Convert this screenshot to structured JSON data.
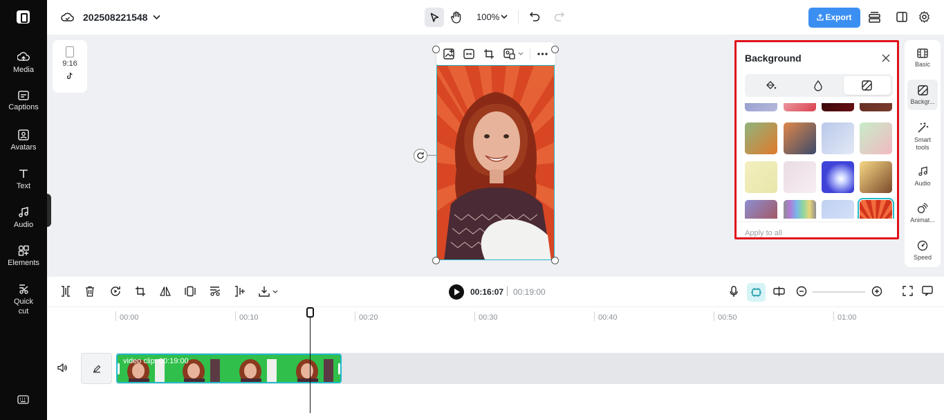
{
  "left_rail": {
    "items": [
      {
        "label": "Media",
        "icon": "media-upload-icon"
      },
      {
        "label": "Captions",
        "icon": "captions-icon"
      },
      {
        "label": "Avatars",
        "icon": "avatar-icon"
      },
      {
        "label": "Text",
        "icon": "text-icon"
      },
      {
        "label": "Audio",
        "icon": "music-note-icon"
      },
      {
        "label": "Elements",
        "icon": "elements-icon"
      },
      {
        "label": "Quick cut",
        "icon": "scissors-icon"
      }
    ]
  },
  "topbar": {
    "project_name": "202508221548",
    "zoom": "100%",
    "export_label": "Export"
  },
  "canvas": {
    "aspect_ratio": "9:16"
  },
  "background_panel": {
    "title": "Background",
    "tabs": [
      {
        "icon": "paint-bucket-icon",
        "active": false
      },
      {
        "icon": "blur-drop-icon",
        "active": false
      },
      {
        "icon": "image-pattern-icon",
        "active": true
      }
    ],
    "thumbnails": [
      {
        "name": "gradient-blue",
        "colors": [
          "#8a92c8",
          "#b5b9dd"
        ]
      },
      {
        "name": "pink-floral",
        "colors": [
          "#f4c6cc",
          "#d9414e"
        ]
      },
      {
        "name": "dark-red",
        "colors": [
          "#1c0406",
          "#6a0e12"
        ]
      },
      {
        "name": "brown-plaid",
        "colors": [
          "#5a2a22",
          "#7a3a2c"
        ]
      },
      {
        "name": "green-orange",
        "colors": [
          "#8fb47d",
          "#e07a2b"
        ]
      },
      {
        "name": "sunset-clouds",
        "colors": [
          "#e0874a",
          "#3b4a6a"
        ]
      },
      {
        "name": "blue-plaid",
        "colors": [
          "#b9c8ea",
          "#e3e9f6"
        ]
      },
      {
        "name": "mint-pink",
        "colors": [
          "#c6ecc8",
          "#f2b9c2"
        ]
      },
      {
        "name": "yellow-daisies",
        "colors": [
          "#f3efc0",
          "#e8e7a8"
        ]
      },
      {
        "name": "pink-marble",
        "colors": [
          "#eadce4",
          "#f6eef2"
        ]
      },
      {
        "name": "blue-light-burst",
        "colors": [
          "#3f43d8",
          "#c9d2ff"
        ]
      },
      {
        "name": "yellow-bear",
        "colors": [
          "#f7d886",
          "#7a4a2a"
        ]
      },
      {
        "name": "purple-fruit-pattern",
        "colors": [
          "#8d8fd2",
          "#a74b4b"
        ]
      },
      {
        "name": "rainbow-stripes",
        "colors": [
          "#b07ad8",
          "#8ed6a2"
        ]
      },
      {
        "name": "blue-bubbles",
        "colors": [
          "#bfd0f1",
          "#d9e4fa"
        ]
      },
      {
        "name": "red-sunburst",
        "colors": [
          "#d2341c",
          "#f26b3c"
        ],
        "selected": true
      }
    ],
    "apply_all_label": "Apply to all"
  },
  "right_rail": {
    "items": [
      {
        "label": "Basic",
        "icon": "film-icon"
      },
      {
        "label": "Backgr...",
        "icon": "background-icon",
        "active": true
      },
      {
        "label": "Smart tools",
        "icon": "magic-wand-icon"
      },
      {
        "label": "Audio",
        "icon": "music-note-icon"
      },
      {
        "label": "Animat...",
        "icon": "animation-icon"
      },
      {
        "label": "Speed",
        "icon": "speed-gauge-icon"
      }
    ]
  },
  "timeline": {
    "current_time": "00:16:07",
    "total_time": "00:19:00",
    "ruler": [
      "00:00",
      "00:10",
      "00:20",
      "00:30",
      "00:40",
      "00:50",
      "01:00"
    ],
    "clip": {
      "label": "video clip",
      "duration": "00:19:00"
    }
  },
  "colors": {
    "accent": "#3b8ff2",
    "selection": "#21b9c7",
    "panel_highlight": "#e0111a",
    "clip_green": "#2fbf4a"
  }
}
